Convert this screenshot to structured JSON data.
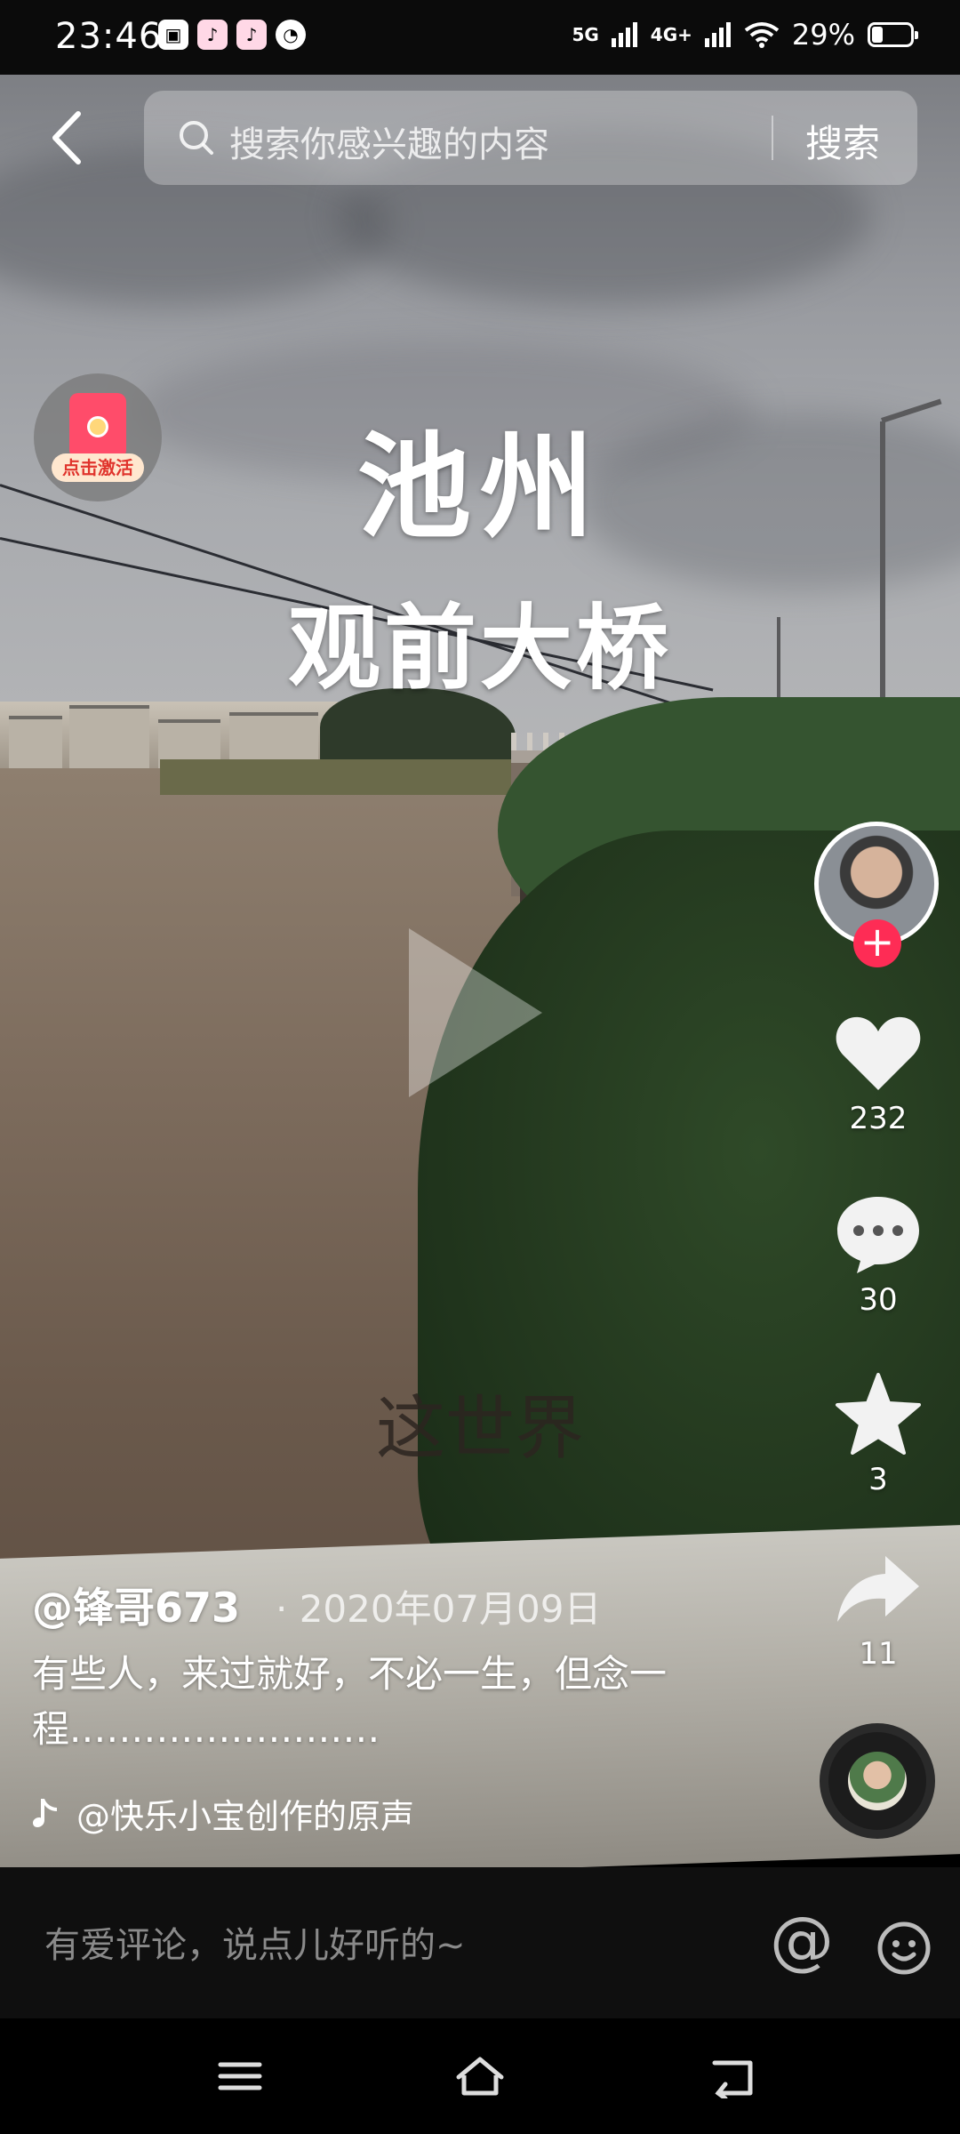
{
  "status_bar": {
    "time": "23:46",
    "net1": "5G",
    "net2": "4G+",
    "battery": "29%"
  },
  "search": {
    "placeholder": "搜索你感兴趣的内容",
    "button_label": "搜索"
  },
  "redpacket": {
    "label": "点击激活"
  },
  "video": {
    "title_line1": "池州",
    "title_line2": "观前大桥",
    "subtitle": "这世界"
  },
  "right_rail": {
    "likes": "232",
    "comments": "30",
    "favorites": "3",
    "shares": "11"
  },
  "post": {
    "username": "@锋哥673",
    "date": "· 2020年07月09日",
    "caption": "有些人，来过就好，不必一生，但念一程.……………………",
    "music": "@快乐小宝创作的原声"
  },
  "comment_bar": {
    "placeholder": "有爱评论，说点儿好听的~",
    "at_symbol": "@"
  },
  "icons": [
    "back-icon",
    "search-icon",
    "heart-icon",
    "comment-icon",
    "star-icon",
    "share-icon",
    "music-note-icon",
    "emoji-icon",
    "menu-icon",
    "home-icon",
    "return-icon"
  ],
  "colors": {
    "accent": "#fe2c55"
  }
}
